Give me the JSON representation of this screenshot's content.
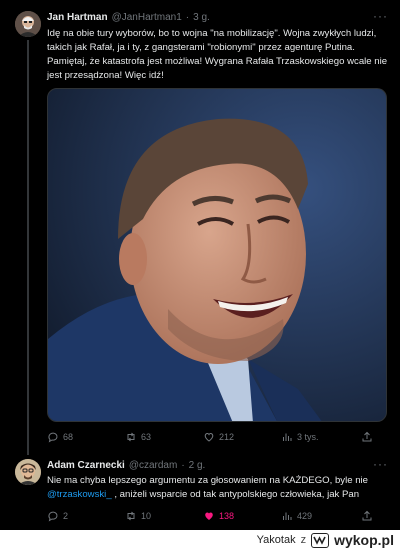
{
  "tweet1": {
    "name": "Jan Hartman",
    "handle": "@JanHartman1",
    "dot": "·",
    "time": "3 g.",
    "more": "···",
    "text": "Idę na obie tury wyborów, bo to wojna \"na mobilizację\". Wojna zwykłych ludzi, takich jak Rafał, ja i ty, z gangsterami \"robionymi\" przez agenturę Putina. Pamiętaj, że katastrofa jest możliwa! Wygrana Rafała Trzaskowskiego wcale nie jest przesądzona! Więc idź!",
    "actions": {
      "replies": "68",
      "reposts": "63",
      "likes": "212",
      "views": "3 tys."
    }
  },
  "tweet2": {
    "name": "Adam Czarnecki",
    "handle": "@czardam",
    "dot": "·",
    "time": "2 g.",
    "more": "···",
    "text_before": "Nie ma chyba lepszego argumentu za głosowaniem na KAŻDEGO, byle nie ",
    "mention": "@trzaskowski_",
    "text_after": " , aniżeli wsparcie od tak antypolskiego człowieka, jak Pan",
    "actions": {
      "replies": "2",
      "reposts": "10",
      "likes": "138",
      "views": "429"
    }
  },
  "watermark": {
    "user": "Yakotak",
    "z": "z",
    "site": "wykop.pl"
  },
  "colors": {
    "background": "#000000",
    "text": "#e7e9ea",
    "muted": "#71767b",
    "link": "#1d9bf0",
    "like": "#f91880"
  }
}
